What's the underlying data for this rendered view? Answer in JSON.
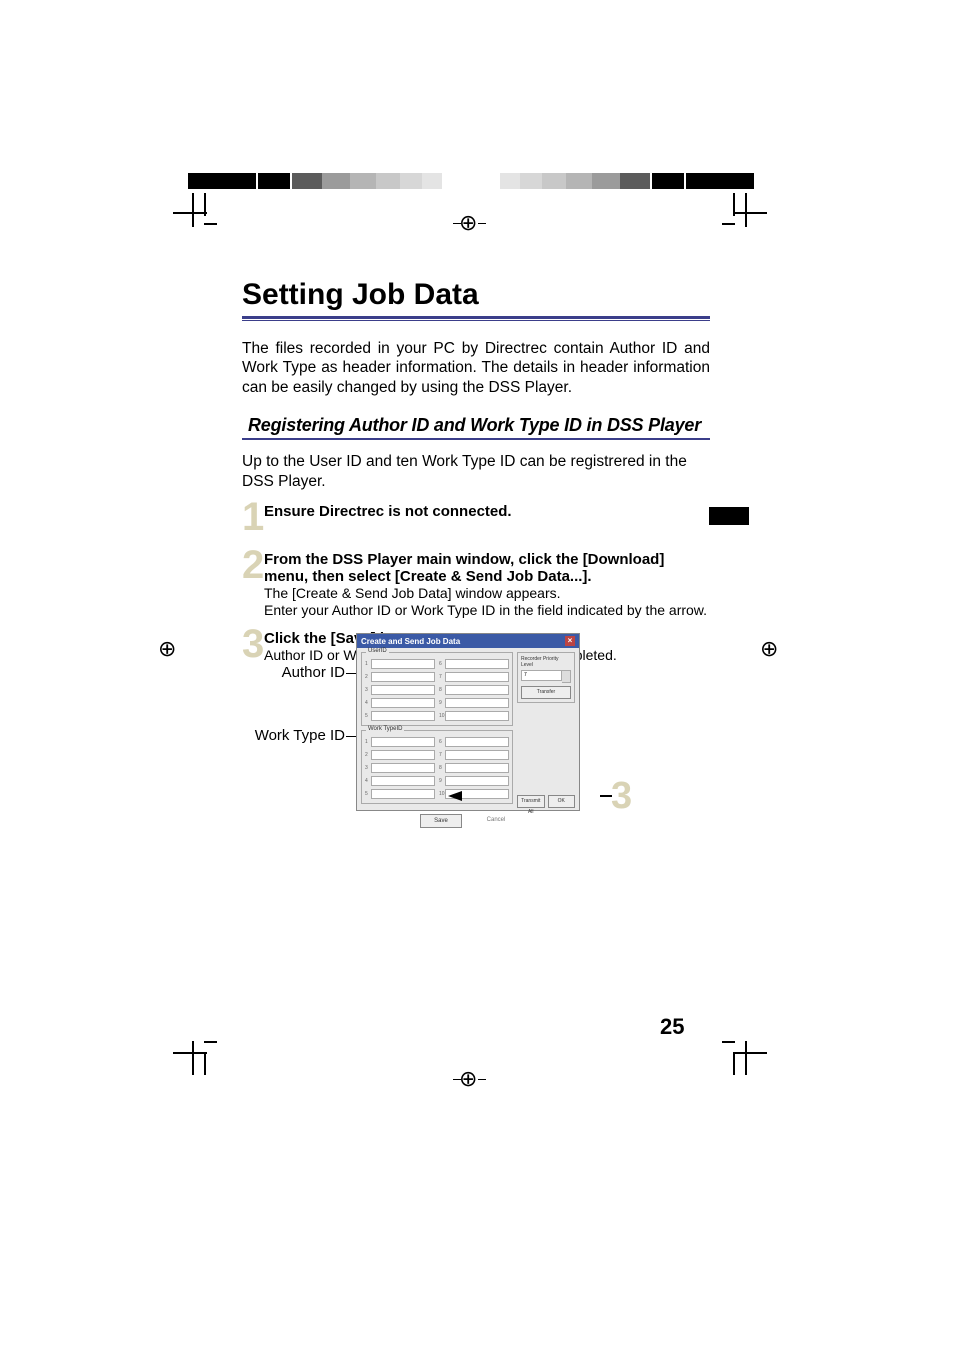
{
  "page_number": "25",
  "title": "Setting Job Data",
  "intro": "The files recorded in your PC by Directrec contain Author ID and Work Type as header information. The details in header information can be easily changed by using the DSS Player.",
  "section_heading": "Registering Author ID and Work Type ID in DSS Player",
  "section_intro": "Up to the User ID and ten Work Type ID can be registrered in the DSS Player.",
  "steps": [
    {
      "num": "1",
      "bold": "Ensure Directrec is not connected.",
      "plain": ""
    },
    {
      "num": "2",
      "bold": "From the DSS Player main window, click the [Download] menu, then select [Create & Send Job Data...].",
      "plain": "The [Create & Send Job Data] window appears.\nEnter your Author ID or Work Type ID in the field indicated by the arrow."
    },
    {
      "num": "3",
      "bold": "Click the [Save] button.",
      "plain": "Author ID or Work Type ID registration is now completed."
    }
  ],
  "labels": {
    "author": "Author ID",
    "work": "Work Type ID"
  },
  "dialog": {
    "title": "Create and Send Job Data",
    "user_legend": "UserID",
    "work_legend": "Work TypeID",
    "priority_label": "Recorder Priority Level",
    "priority_value": "7",
    "transfer": "Transfer",
    "transmit": "Transmit All",
    "ok": "OK",
    "save": "Save",
    "cancel": "Cancel"
  },
  "big_callout": "3"
}
